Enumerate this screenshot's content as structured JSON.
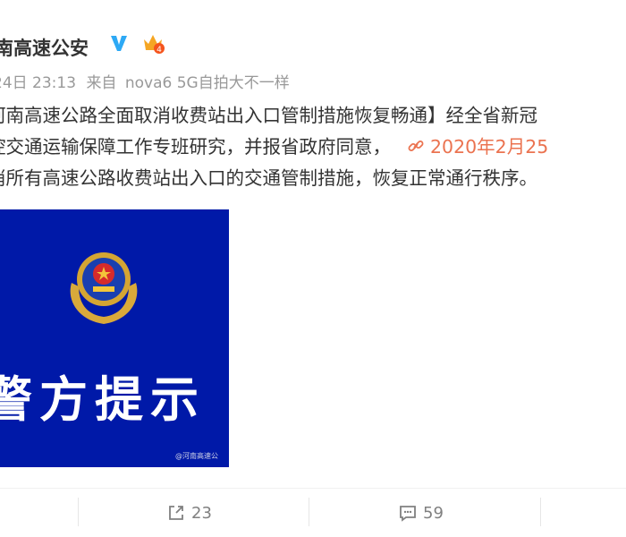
{
  "post": {
    "author": "南高速公安",
    "time": "24日 23:13",
    "source_prefix": "来自",
    "device": "nova6 5G自拍大不一样",
    "text_lines": [
      "河南高速公路全面取消收费站出入口管制措施恢复畅通】经全省新冠",
      "控交通运输保障工作专班研究，并报省政府同意，",
      "消所有高速公路收费站出入口的交通管制措施，恢复正常通行秩序。"
    ],
    "link_text": "2020年2月25",
    "image": {
      "caption": "警方提示",
      "watermark": "@河南高速公"
    }
  },
  "actions": {
    "share_count": "23",
    "comment_count": "59"
  },
  "colors": {
    "link": "#eb7350",
    "verified": "#2da9f5",
    "image_bg": "#0019a8",
    "meta": "#999999"
  },
  "icons": [
    "verified-icon",
    "crown-badge-icon",
    "link-icon",
    "share-icon",
    "comment-icon",
    "police-emblem"
  ]
}
